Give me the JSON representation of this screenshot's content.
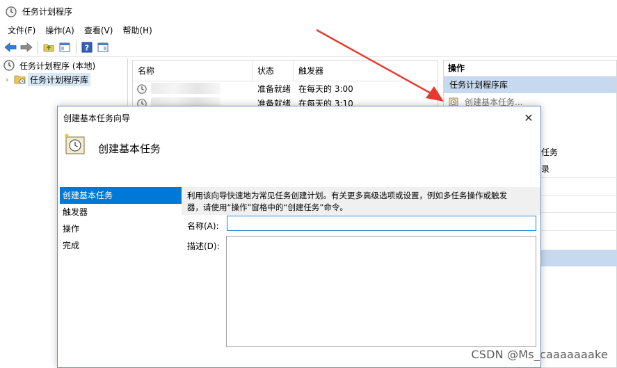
{
  "window": {
    "title": "任务计划程序"
  },
  "menu": [
    "文件(F)",
    "操作(A)",
    "查看(V)",
    "帮助(H)"
  ],
  "tree": {
    "root": "任务计划程序 (本地)",
    "library": "任务计划程序库"
  },
  "list": {
    "columns": [
      "名称",
      "状态",
      "触发器"
    ],
    "rows": [
      {
        "status": "准备就绪",
        "trigger": "在每天的 3:00"
      },
      {
        "status": "准备就绪",
        "trigger": "在每天的 3:10"
      }
    ]
  },
  "actions": {
    "header": "操作",
    "section": "任务计划程序库",
    "create_basic": "创建基本任务...",
    "peek1": "任务",
    "peek2": "录"
  },
  "dialog": {
    "title": "创建基本任务向导",
    "heading": "创建基本任务",
    "close": "✕",
    "steps": [
      "创建基本任务",
      "触发器",
      "操作",
      "完成"
    ],
    "description_line1": "利用该向导快速地为常见任务创建计划。有关更多高级选项或设置，例如多任务操作或触发",
    "description_line2": "器，请使用“操作”窗格中的“创建任务”命令。",
    "name_label": "名称(A):",
    "name_value": "",
    "desc_label": "描述(D):",
    "desc_value": ""
  },
  "watermark": "CSDN @Ms_caaaaaaake",
  "colors": {
    "accent": "#0078d7",
    "section": "#c7d9ee",
    "arrow": "#e8392f"
  }
}
